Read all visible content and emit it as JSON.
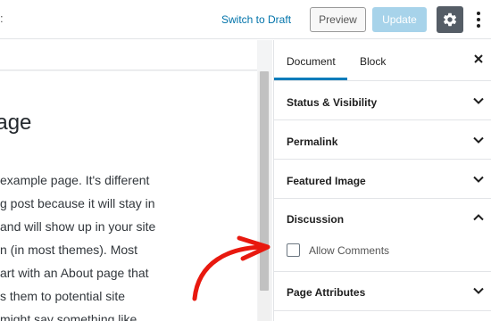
{
  "topbar": {
    "partial_text": ":",
    "switch_to_draft": "Switch to Draft",
    "preview": "Preview",
    "update": "Update",
    "settings_icon": "gear-icon",
    "more_icon": "vertical-ellipsis-icon"
  },
  "editor": {
    "title": "le Page",
    "paragraph_lines": [
      "example page. It's different",
      "g post because it will stay in",
      "and will show up in your site",
      "n (in most themes). Most",
      "art with an About page that",
      "s them to potential site",
      "might say something like"
    ]
  },
  "sidebar": {
    "tabs": [
      "Document",
      "Block"
    ],
    "close_icon": "close-icon",
    "panels": [
      {
        "title": "Status & Visibility",
        "state": "collapsed"
      },
      {
        "title": "Permalink",
        "state": "collapsed"
      },
      {
        "title": "Featured Image",
        "state": "collapsed"
      },
      {
        "title": "Discussion",
        "state": "expanded"
      },
      {
        "title": "Page Attributes",
        "state": "collapsed"
      }
    ],
    "discussion": {
      "allow_comments_label": "Allow Comments",
      "allow_comments_checked": false
    }
  },
  "annotation": {
    "type": "red-arrow-icon",
    "color": "#e8190f"
  },
  "colors": {
    "accent": "#007cba",
    "link": "#0073aa",
    "update_disabled": "#a7d3ea",
    "settings_active": "#555d66"
  }
}
